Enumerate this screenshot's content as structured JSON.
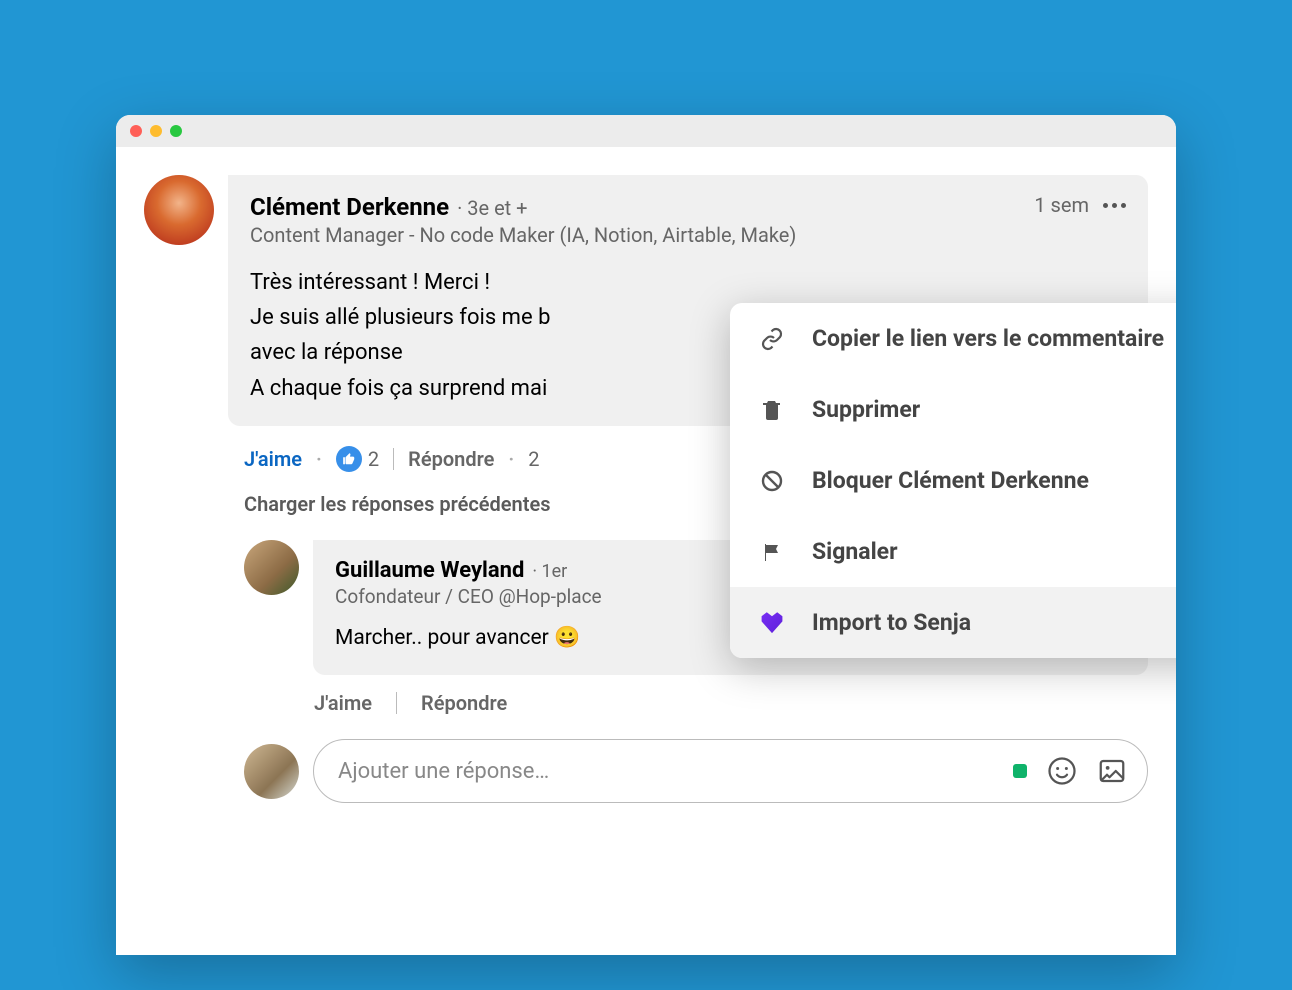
{
  "comment": {
    "author": "Clément Derkenne",
    "degree": "3e et +",
    "job": "Content Manager - No code Maker (IA, Notion, Airtable, Make)",
    "time": "1 sem",
    "body": "Très intéressant ! Merci !\nJe suis allé plusieurs fois me b\navec la réponse\nA chaque fois ça surprend mai"
  },
  "actions": {
    "like": "J'aime",
    "like_count": "2",
    "reply": "Répondre",
    "extra": "2",
    "dot": "·"
  },
  "load_previous": "Charger les réponses précédentes",
  "reply": {
    "author": "Guillaume Weyland",
    "degree": "1er",
    "job": "Cofondateur / CEO @Hop-place",
    "body": "Marcher.. pour avancer 😀"
  },
  "reply_actions": {
    "like": "J'aime",
    "reply": "Répondre"
  },
  "compose": {
    "placeholder": "Ajouter une réponse…"
  },
  "menu": {
    "copy_link": "Copier le lien vers le commentaire",
    "delete": "Supprimer",
    "block": "Bloquer Clément Derkenne",
    "report": "Signaler",
    "import_senja": "Import to Senja"
  }
}
